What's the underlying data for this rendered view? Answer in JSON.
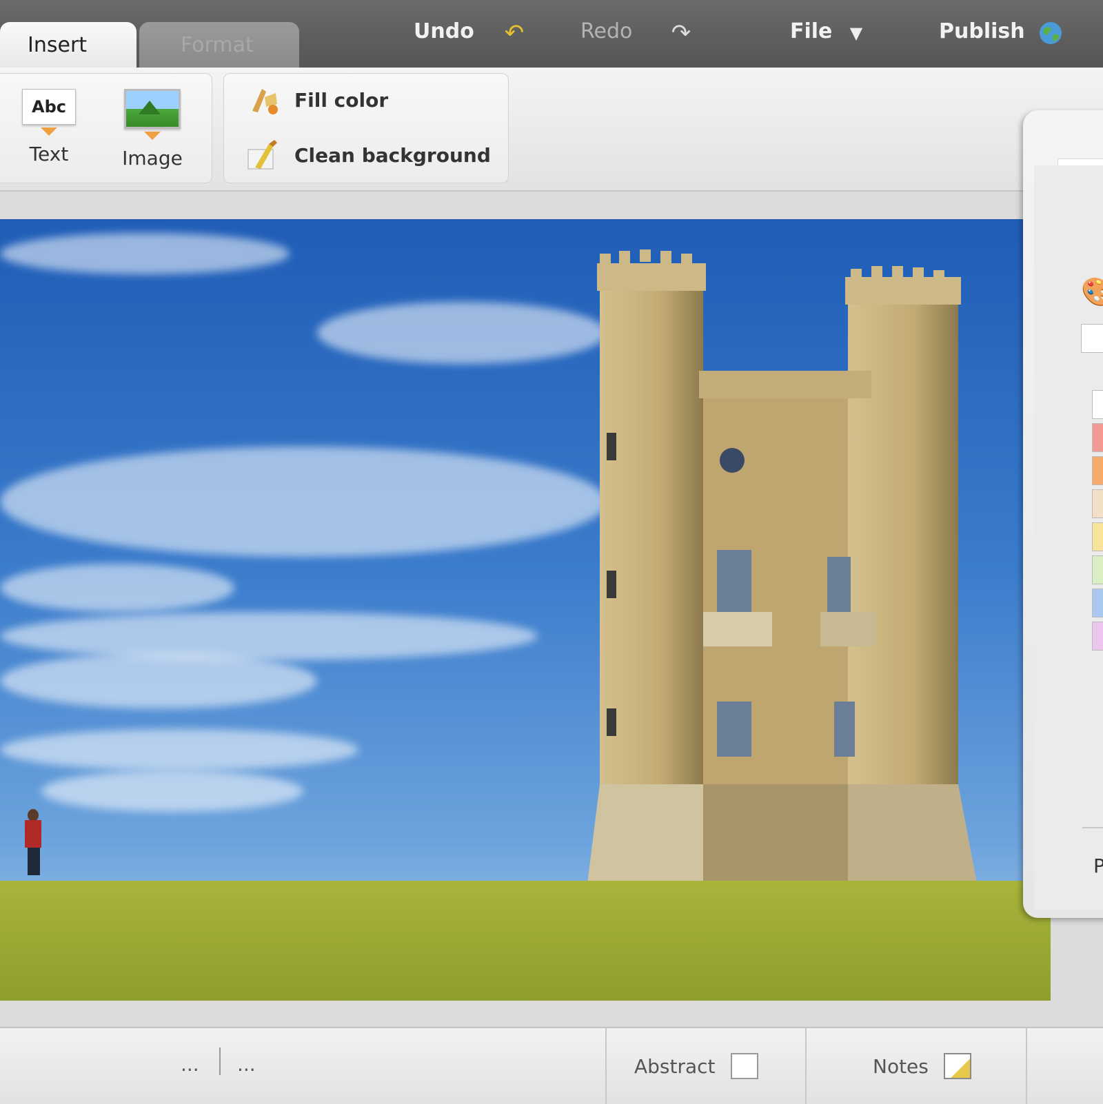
{
  "toolbar": {
    "tabs": [
      {
        "label": "Insert",
        "active": true
      },
      {
        "label": "Format",
        "active": false
      }
    ],
    "undo_label": "Undo",
    "redo_label": "Redo",
    "file_label": "File",
    "publish_label": "Publish"
  },
  "ribbon": {
    "insert_group": [
      {
        "label": "Text",
        "icon": "text-abc-icon",
        "glyph": "Abc"
      },
      {
        "label": "Image",
        "icon": "image-icon"
      }
    ],
    "background_group": [
      {
        "label": "Fill color",
        "icon": "fill-color-icon"
      },
      {
        "label": "Clean background",
        "icon": "clean-background-icon"
      }
    ]
  },
  "panel": {
    "partial_label": "P",
    "swatches": [
      "#ffffff",
      "#f49a95",
      "#f7a96a",
      "#f3dfc8",
      "#f7e49a",
      "#d9efc2",
      "#a9c8f2",
      "#ecc6ec"
    ]
  },
  "statusbar": {
    "page_nav_left": "...",
    "page_nav_right": "...",
    "abstract_label": "Abstract",
    "notes_label": "Notes"
  }
}
